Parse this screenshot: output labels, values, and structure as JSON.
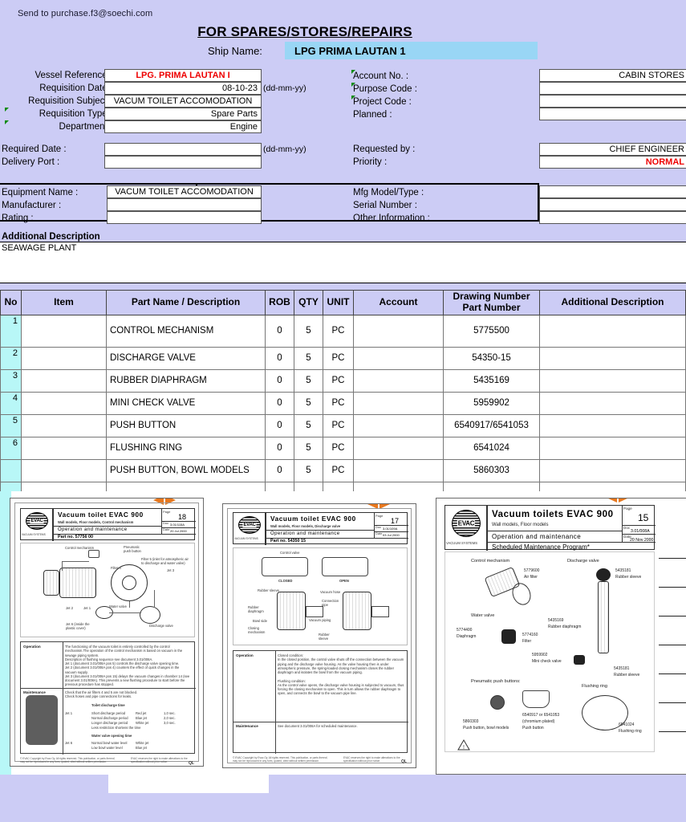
{
  "header": {
    "email_line": "Send to purchase.f3@soechi.com",
    "doc_title": "FOR SPARES/STORES/REPAIRS",
    "ship_name_label": "Ship Name:",
    "ship_name_value": "LPG PRIMA LAUTAN 1",
    "ship_name_bg": "#99d6f5"
  },
  "form_left": {
    "vessel_reference_label": "Vessel Reference :",
    "vessel_reference_value": "LPG. PRIMA LAUTAN I",
    "requisition_date_label": "Requisition Date :",
    "requisition_date_value": "08-10-23",
    "requisition_date_hint": "(dd-mm-yy)",
    "requisition_subject_label": "Requisition Subject :",
    "requisition_subject_value": "VACUM TOILET ACCOMODATION",
    "requisition_type_label": "Requisition Type  :",
    "requisition_type_value": "Spare Parts",
    "department_label": "Department   :",
    "department_value": "Engine",
    "required_date_label": "Required Date :",
    "required_date_value": "",
    "required_date_hint": "(dd-mm-yy)",
    "delivery_port_label": "Delivery Port :",
    "delivery_port_value": ""
  },
  "form_right": {
    "account_no_label": "Account No.  :",
    "account_no_value": "CABIN STORES",
    "purpose_code_label": "Purpose Code  :",
    "purpose_code_value": "",
    "project_code_label": "Project Code  :",
    "project_code_value": "",
    "planned_label": "Planned :",
    "planned_value": "",
    "requested_by_label": "Requested by :",
    "requested_by_value": "CHIEF ENGINEER",
    "priority_label": "Priority :",
    "priority_value": "NORMAL",
    "priority_color": "#ee0000"
  },
  "equipment": {
    "equipment_name_label": "Equipment Name :",
    "equipment_name_value": "VACUM TOILET  ACCOMODATION",
    "manufacturer_label": "Manufacturer :",
    "manufacturer_value": "",
    "rating_label": "Rating :",
    "rating_value": "",
    "mfg_model_label": "Mfg Model/Type :",
    "mfg_model_value": "",
    "serial_number_label": "Serial Number :",
    "serial_number_value": "",
    "other_information_label": "Other Information :",
    "other_information_value": ""
  },
  "additional_description": {
    "title": "Additional Description",
    "text": "SEAWAGE PLANT"
  },
  "parts_table": {
    "columns": [
      "No",
      "Item",
      "Part Name / Description",
      "ROB",
      "QTY",
      "UNIT",
      "Account",
      "Drawing Number\nPart Number",
      "Additional Description"
    ],
    "col_drawing_line1": "Drawing Number",
    "col_drawing_line2": "Part Number",
    "rows": [
      {
        "no": "1",
        "item": "",
        "part_name": "CONTROL MECHANISM",
        "rob": "0",
        "qty": "5",
        "unit": "PC",
        "account": "",
        "drawing_number": "5775500",
        "additional": ""
      },
      {
        "no": "2",
        "item": "",
        "part_name": "DISCHARGE VALVE",
        "rob": "0",
        "qty": "5",
        "unit": "PC",
        "account": "",
        "drawing_number": "54350-15",
        "additional": ""
      },
      {
        "no": "3",
        "item": "",
        "part_name": "RUBBER DIAPHRAGM",
        "rob": "0",
        "qty": "5",
        "unit": "PC",
        "account": "",
        "drawing_number": "5435169",
        "additional": ""
      },
      {
        "no": "4",
        "item": "",
        "part_name": "MINI CHECK VALVE",
        "rob": "0",
        "qty": "5",
        "unit": "PC",
        "account": "",
        "drawing_number": "5959902",
        "additional": ""
      },
      {
        "no": "5",
        "item": "",
        "part_name": "PUSH BUTTON",
        "rob": "0",
        "qty": "5",
        "unit": "PC",
        "account": "",
        "drawing_number": "6540917/6541053",
        "additional": ""
      },
      {
        "no": "6",
        "item": "",
        "part_name": "FLUSHING RING",
        "rob": "0",
        "qty": "5",
        "unit": "PC",
        "account": "",
        "drawing_number": "6541024",
        "additional": ""
      },
      {
        "no": "",
        "item": "",
        "part_name": "PUSH BUTTON, BOWL MODELS",
        "rob": "0",
        "qty": "5",
        "unit": "PC",
        "account": "",
        "drawing_number": "5860303",
        "additional": ""
      },
      {
        "no": "",
        "item": "",
        "part_name": "",
        "rob": "",
        "qty": "",
        "unit": "",
        "account": "",
        "drawing_number": "",
        "additional": ""
      }
    ]
  },
  "scans": [
    {
      "id": "scan-page-18",
      "title": "Vacuum toilet  EVAC  900",
      "subtitle": "Wall models, Floor models, Control mechanism",
      "section": "Operation  and  maintenance",
      "part_line": "Part no. 57756 00",
      "page_caption": "Page",
      "page_number": "18",
      "doc_caption": "Doc",
      "doc_number": "3.01/115A",
      "date_caption": "Date",
      "date_value": "20 Jul 2000",
      "logo_text": "EVAC",
      "logo_sub": "VACUUM SYSTEMS",
      "diagram_labels": [
        "Control mechanism",
        "Pneumatic push button",
        "Filter 5 (inlet for atmospheric air to discharge and water valve)",
        "Filter 4",
        "Jet 3",
        "Jet 2",
        "Jet 1",
        "Water valve",
        "Jet 6 (inside the plastic cover)",
        "Discharge valve"
      ],
      "blocks": [
        {
          "label": "Operation",
          "text": "The functioning of the vacuum toilet is entirely controlled by the control mechanism.The operation of the control mechanism is based on vacuum in the sewage piping system.\nDescription of flushing sequence see document 3.01/008A.\nJet 1 (document 3.01/008A pos 5) controls the discharge valve opening time.\nJet 2 (document 3.01/008A pos 4) counters the effect of quick changes in the vacuum supply.\nJet 3 (document 3.01/008A pos 15) delays the vacuum changes in chamber 14 (see document 3.01/008A). This prevents a new flushing procedure to start before the previous procedure has stopped."
        },
        {
          "label": "Maintenance",
          "text": "Check that the air filters 4 and 5 are not blocked.\nCheck hoses and pipe connections for leaks."
        }
      ],
      "table_title": "Toilet discharge time",
      "table_rows": [
        [
          "Jet 1",
          "Short discharge period",
          "Red jet",
          "1,0 sec."
        ],
        [
          "",
          "Normal discharge period",
          "Blue jet",
          "2,0 sec."
        ],
        [
          "",
          "Longer discharge period",
          "White jet",
          "3,0 sec."
        ],
        [
          "",
          "Less restriction shortens the time",
          "",
          ""
        ]
      ],
      "table_title2": "Water valve opening time",
      "table_rows2": [
        [
          "Jet 6",
          "Normal bowl water level",
          "White jet",
          ""
        ],
        [
          "",
          "Low bowl water level",
          "Blue jet",
          ""
        ]
      ],
      "page_mark": "QL"
    },
    {
      "id": "scan-page-17",
      "title": "Vacuum toilet  EVAC  900",
      "subtitle": "Wall models, Floor models, Discharge valve",
      "section": "Operation  and  maintenance",
      "part_line": "Part no. 54350 15",
      "page_caption": "Page",
      "page_number": "17",
      "doc_caption": "Doc",
      "doc_number": "3.01/109A",
      "date_caption": "Date",
      "date_value": "03 Jul 2000",
      "logo_text": "EVAC",
      "logo_sub": "VACUUM SYSTEMS",
      "diagram_labels": [
        "Control valve",
        "CLOSED",
        "OPEN",
        "Rubber sleeve",
        "Vacuum hose",
        "Connection pipe",
        "Rubber diaphragm",
        "Bowl side",
        "Vacuum piping",
        "Closing mechanism",
        "Rubber sleeve"
      ],
      "blocks": [
        {
          "label": "Operation",
          "text": "Closed condition:\nIn the closed position, the control valve shuts off the connection between the vacuum piping and the discharge valve housing. As the valve housing then is under atmospheric pressure, the spring-loaded closing mechanism closes the rubber diaphragm and isolates the bowl from the vacuum piping.\n\nFlushing condition:\nAs the control valve opens, the discharge valve housing is subjected to vacuum, thus forcing the closing mechanism to open. This in turn allows the rubber diaphragm to open, and connects the bowl to the vacuum pipe line."
        },
        {
          "label": "Maintenance",
          "text": "See document 3.01/008A for scheduled maintenance."
        }
      ],
      "page_mark": "QL"
    },
    {
      "id": "scan-page-15",
      "title": "Vacuum toilets  EVAC  900",
      "subtitle": "Wall models, Floor models",
      "section": "Operation  and  maintenance",
      "part_line": "Scheduled  Maintenance  Program*",
      "page_caption": "Page",
      "page_number": "15",
      "doc_caption": "Doc",
      "doc_number": "3.01/008A",
      "date_caption": "Date",
      "date_value": "20 Nov 2000",
      "logo_text": "EVAC",
      "logo_sub": "VACUUM SYSTEMS",
      "groups": [
        {
          "heading": "Control mechanism",
          "items": [
            {
              "code": "5779600",
              "name": "Air filter"
            }
          ]
        },
        {
          "heading": "Discharge valve",
          "items": [
            {
              "code": "5435181",
              "name": "Rubber sleeve"
            },
            {
              "code": "5435169",
              "name": "Rubber diaphragm"
            },
            {
              "code": "5959902",
              "name": "Mini check valve"
            },
            {
              "code": "5435181",
              "name": "Rubber sleeve"
            }
          ]
        },
        {
          "heading": "Water valve",
          "items": [
            {
              "code": "5774400",
              "name": "Diaphragm"
            },
            {
              "code": "5774160",
              "name": "Filter"
            }
          ]
        },
        {
          "heading": "Pneumatic push buttons:",
          "items": [
            {
              "code": "5860303",
              "name": "Push button, bowl models"
            },
            {
              "code": "6540917 or 6541053 (chromium plated)",
              "name": "Push button"
            }
          ]
        },
        {
          "heading": "Flushing ring",
          "items": [
            {
              "code": "6541024",
              "name": "Flushing ring"
            }
          ]
        }
      ]
    }
  ],
  "colors": {
    "sheet_bg": "#ccccf5",
    "field_bg": "#ffffff",
    "no_col_bg": "#b8f7f7",
    "accent_red": "#ee0000",
    "ship_bar": "#99d6f5",
    "arrow_orange": "#e8781e"
  }
}
